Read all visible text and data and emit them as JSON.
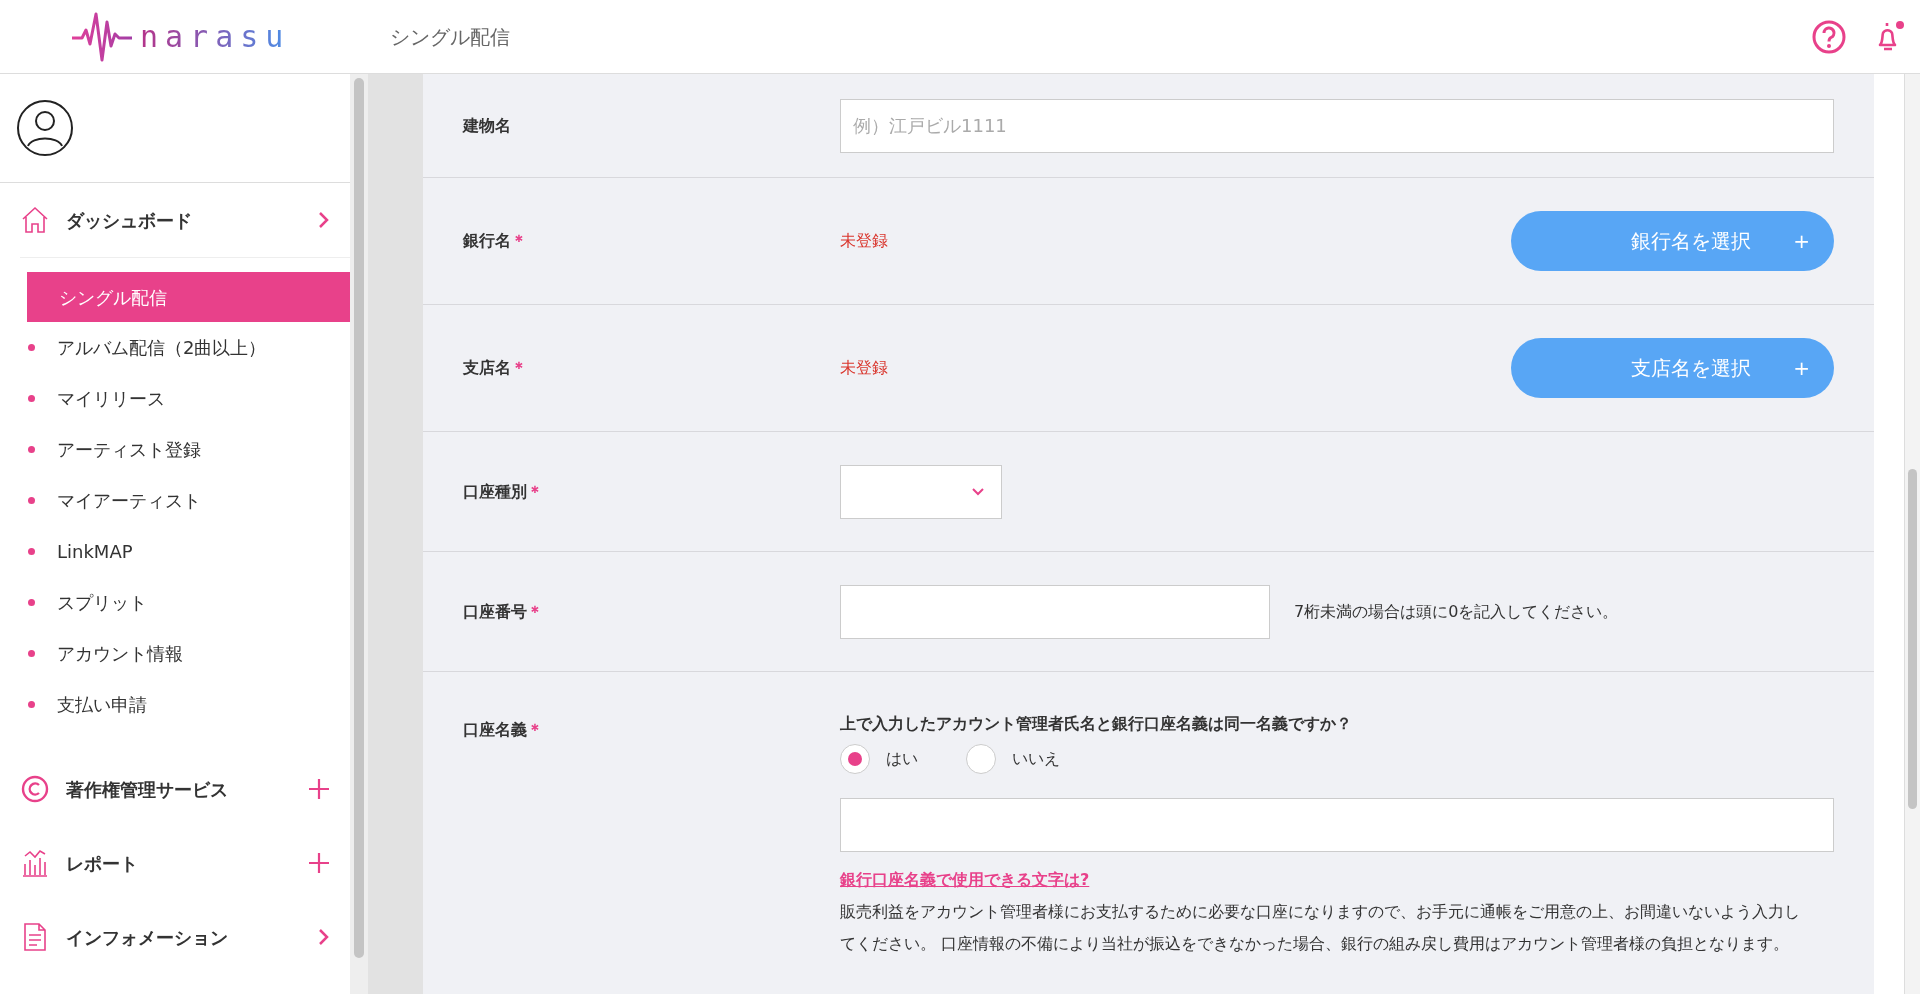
{
  "header": {
    "logo": "narasu",
    "page_title": "シングル配信"
  },
  "sidebar": {
    "sections": [
      {
        "label": "ダッシュボード",
        "kind": "chevron",
        "children": [
          {
            "label": "シングル配信",
            "selected": true
          },
          {
            "label": "アルバム配信（2曲以上）",
            "selected": false
          },
          {
            "label": "マイリリース",
            "selected": false
          },
          {
            "label": "アーティスト登録",
            "selected": false
          },
          {
            "label": "マイアーティスト",
            "selected": false
          },
          {
            "label": "LinkMAP",
            "selected": false
          },
          {
            "label": "スプリット",
            "selected": false
          },
          {
            "label": "アカウント情報",
            "selected": false
          },
          {
            "label": "支払い申請",
            "selected": false
          }
        ]
      },
      {
        "label": "著作権管理サービス",
        "kind": "plus"
      },
      {
        "label": "レポート",
        "kind": "plus"
      },
      {
        "label": "インフォメーション",
        "kind": "chevron"
      }
    ]
  },
  "form": {
    "rows": [
      {
        "kind": "text",
        "label": "建物名",
        "placeholder": "例）江戸ビル1111"
      },
      {
        "kind": "picker",
        "label": "銀行名",
        "required_mark": "＊",
        "status": "未登録",
        "button": "銀行名を選択",
        "button_icon": "+"
      },
      {
        "kind": "picker",
        "label": "支店名",
        "required_mark": "＊",
        "status": "未登録",
        "button": "支店名を選択",
        "button_icon": "+"
      },
      {
        "kind": "select",
        "label": "口座種別",
        "required_mark": "＊"
      },
      {
        "kind": "number",
        "label": "口座番号",
        "required_mark": "＊",
        "note": "7桁未満の場合は頭に0を記入してください。"
      },
      {
        "kind": "holder",
        "label": "口座名義",
        "required_mark": "＊",
        "question": "上で入力したアカウント管理者氏名と銀行口座名義は同一名義ですか？",
        "options": [
          {
            "label": "はい",
            "selected": true
          },
          {
            "label": "いいえ",
            "selected": false
          }
        ],
        "link": "銀行口座名義で使用できる文字は?",
        "description": "販売利益をアカウント管理者様にお支払するために必要な口座になりますので、お手元に通帳をご用意の上、お間違いないよう入力してください。 口座情報の不備により当社が振込をできなかった場合、銀行の組み戻し費用はアカウント管理者様の負担となります。"
      }
    ]
  }
}
